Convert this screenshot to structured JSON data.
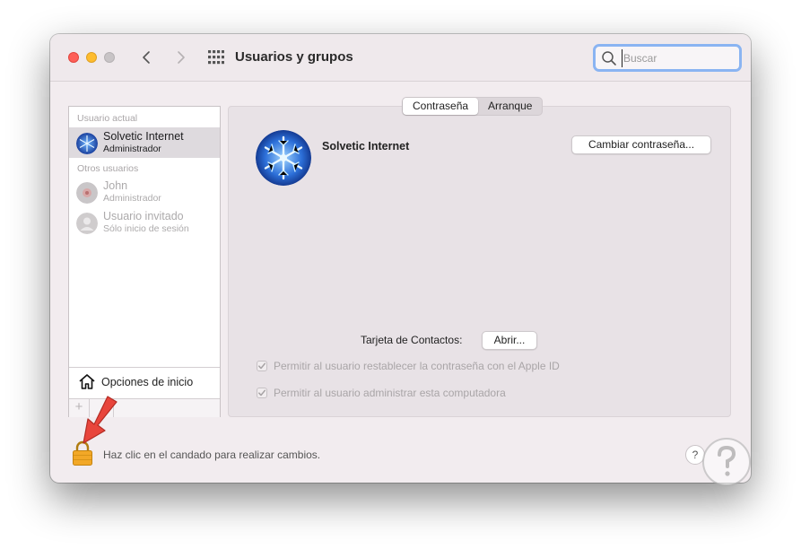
{
  "window": {
    "title": "Usuarios y grupos",
    "search_placeholder": "Buscar"
  },
  "sidebar": {
    "current_user_label": "Usuario actual",
    "other_users_label": "Otros usuarios",
    "users": [
      {
        "name": "Solvetic Internet",
        "role": "Administrador",
        "selected": true,
        "enabled": true
      },
      {
        "name": "John",
        "role": "Administrador",
        "selected": false,
        "enabled": false
      },
      {
        "name": "Usuario invitado",
        "role": "Sólo inicio de sesión",
        "selected": false,
        "enabled": false
      }
    ],
    "login_options_label": "Opciones de inicio",
    "add_label": "+"
  },
  "tabs": [
    {
      "label": "Contraseña",
      "active": true
    },
    {
      "label": "Arranque",
      "active": false
    }
  ],
  "main": {
    "user_name": "Solvetic Internet",
    "change_password_label": "Cambiar contraseña...",
    "contact_card_label": "Tarjeta de Contactos:",
    "open_label": "Abrir...",
    "checkboxes": [
      {
        "label": "Permitir al usuario restablecer la contraseña con el Apple ID",
        "checked": true,
        "enabled": false
      },
      {
        "label": "Permitir al usuario administrar esta computadora",
        "checked": true,
        "enabled": false
      }
    ]
  },
  "footer": {
    "lock_text": "Haz clic en el candado para realizar cambios.",
    "help_label": "?"
  },
  "colors": {
    "close": "#fe5f57",
    "minimize": "#febc2e",
    "search_focus": "#8ab4f2",
    "lock": "#f2a827",
    "annotation_arrow": "#e8453c"
  }
}
